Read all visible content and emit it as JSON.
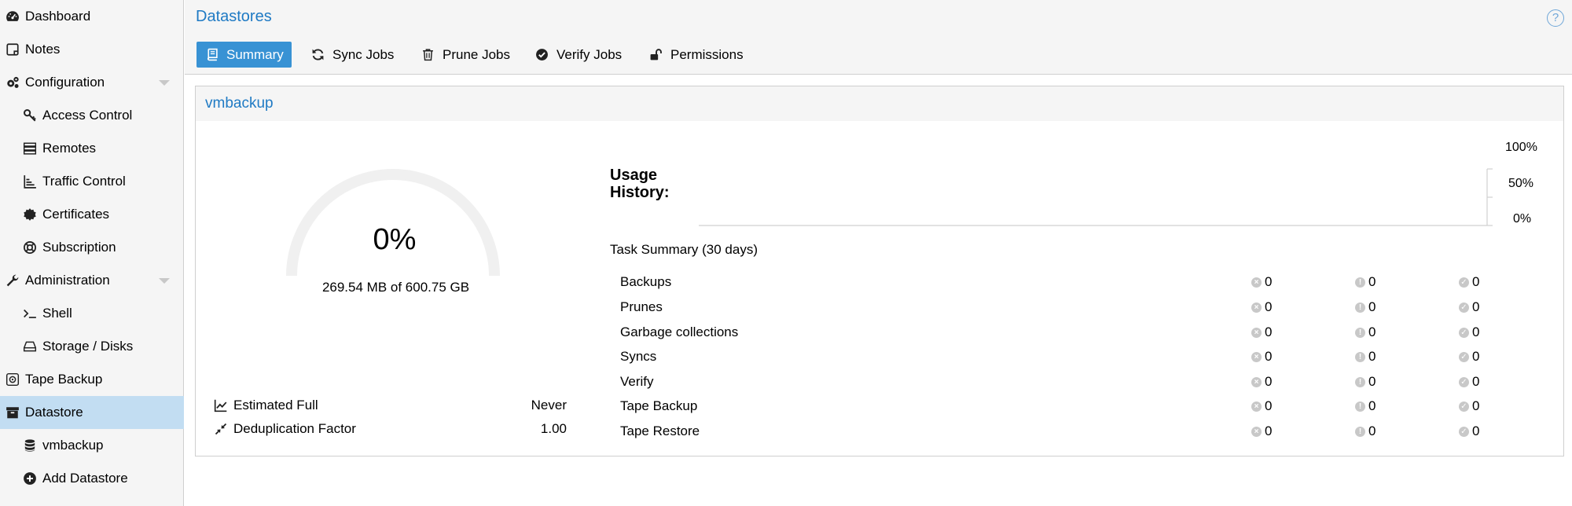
{
  "sidebar": {
    "items": [
      {
        "label": "Dashboard",
        "icon": "dashboard-icon"
      },
      {
        "label": "Notes",
        "icon": "notes-icon"
      },
      {
        "label": "Configuration",
        "icon": "gears-icon"
      },
      {
        "label": "Access Control",
        "icon": "key-icon"
      },
      {
        "label": "Remotes",
        "icon": "server-icon"
      },
      {
        "label": "Traffic Control",
        "icon": "signal-bars-icon"
      },
      {
        "label": "Certificates",
        "icon": "certificate-icon"
      },
      {
        "label": "Subscription",
        "icon": "lifebuoy-icon"
      },
      {
        "label": "Administration",
        "icon": "wrench-icon"
      },
      {
        "label": "Shell",
        "icon": "terminal-icon"
      },
      {
        "label": "Storage / Disks",
        "icon": "hdd-icon"
      },
      {
        "label": "Tape Backup",
        "icon": "tape-icon"
      },
      {
        "label": "Datastore",
        "icon": "archive-icon"
      },
      {
        "label": "vmbackup",
        "icon": "database-icon"
      },
      {
        "label": "Add Datastore",
        "icon": "plus-circle-icon"
      }
    ]
  },
  "header": {
    "title": "Datastores",
    "help_label": "?"
  },
  "tabs": [
    {
      "label": "Summary",
      "icon": "book-icon"
    },
    {
      "label": "Sync Jobs",
      "icon": "refresh-icon"
    },
    {
      "label": "Prune Jobs",
      "icon": "trash-icon"
    },
    {
      "label": "Verify Jobs",
      "icon": "check-circle-icon"
    },
    {
      "label": "Permissions",
      "icon": "unlock-icon"
    }
  ],
  "panel": {
    "title": "vmbackup",
    "gauge": {
      "percent_label": "0%",
      "usage_text": "269.54 MB of 600.75 GB",
      "fraction": 0
    },
    "stats": [
      {
        "label": "Estimated Full",
        "value": "Never",
        "icon": "line-chart-icon"
      },
      {
        "label": "Deduplication Factor",
        "value": "1.00",
        "icon": "compress-icon"
      }
    ],
    "usage_history": {
      "label_line1": "Usage",
      "label_line2": "History:",
      "ticks": [
        "100%",
        "50%",
        "0%"
      ]
    },
    "task_summary": {
      "title": "Task Summary (30 days)",
      "rows": [
        {
          "name": "Backups",
          "error": "0",
          "warning": "0",
          "ok": "0"
        },
        {
          "name": "Prunes",
          "error": "0",
          "warning": "0",
          "ok": "0"
        },
        {
          "name": "Garbage collections",
          "error": "0",
          "warning": "0",
          "ok": "0"
        },
        {
          "name": "Syncs",
          "error": "0",
          "warning": "0",
          "ok": "0"
        },
        {
          "name": "Verify",
          "error": "0",
          "warning": "0",
          "ok": "0"
        },
        {
          "name": "Tape Backup",
          "error": "0",
          "warning": "0",
          "ok": "0"
        },
        {
          "name": "Tape Restore",
          "error": "0",
          "warning": "0",
          "ok": "0"
        }
      ]
    }
  },
  "colors": {
    "accent": "#3892d4",
    "title_blue": "#1f7ac4",
    "selected_bg": "#c2ddf2"
  }
}
